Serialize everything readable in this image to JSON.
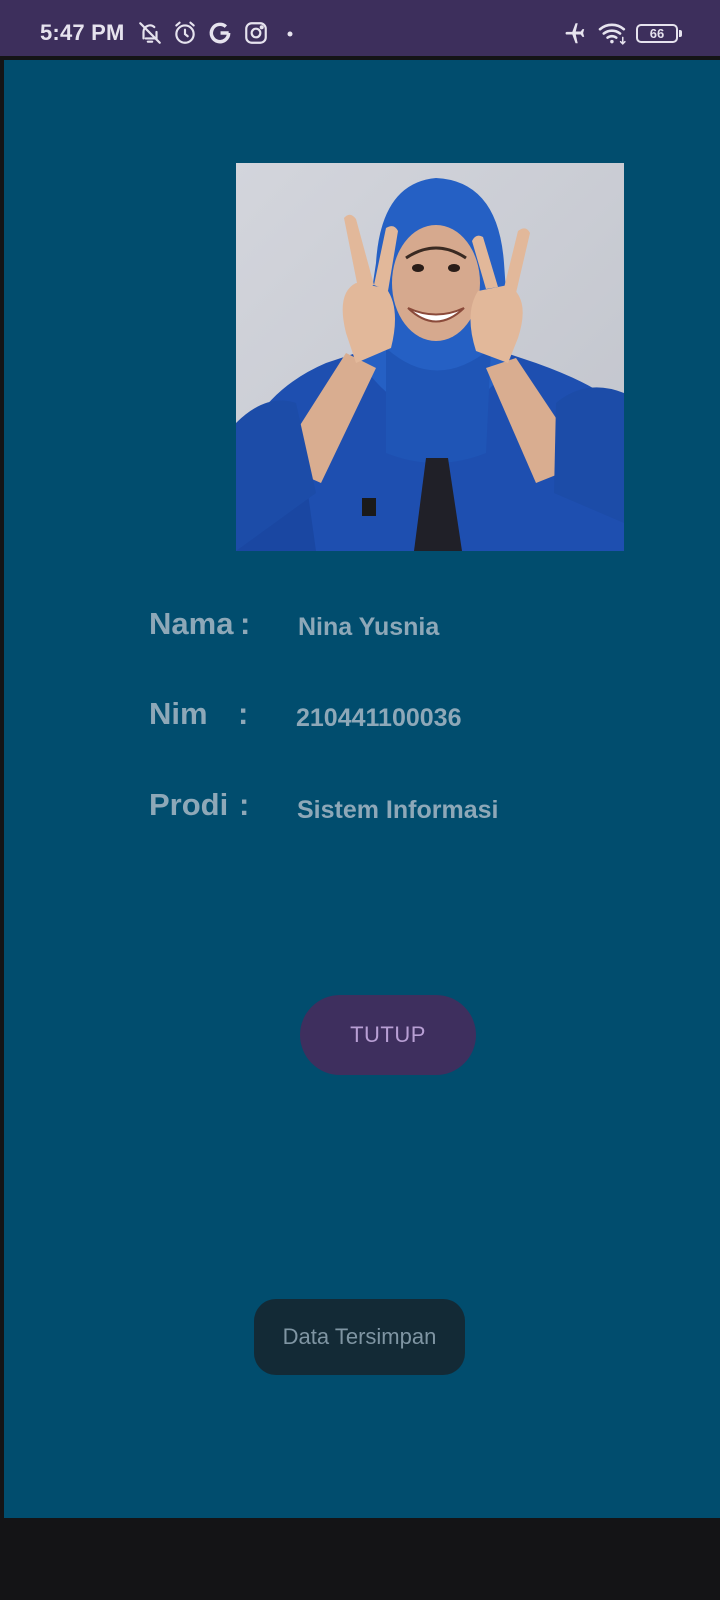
{
  "status_bar": {
    "time": "5:47 PM",
    "icons_left": [
      "notifications-off-icon",
      "alarm-icon",
      "google-icon",
      "instagram-icon",
      "dot-icon"
    ],
    "icons_right": [
      "airplane-icon",
      "wifi-icon",
      "battery-icon"
    ],
    "battery_level": "66"
  },
  "profile": {
    "photo_icon": "profile-photo",
    "fields": [
      {
        "label": "Nama",
        "colon": ":",
        "value": "Nina Yusnia"
      },
      {
        "label": "Nim",
        "colon": ":",
        "value": "210441100036"
      },
      {
        "label": "Prodi",
        "colon": ":",
        "value": "Sistem Informasi"
      }
    ]
  },
  "actions": {
    "close_label": "TUTUP"
  },
  "toast": {
    "message": "Data Tersimpan"
  },
  "colors": {
    "status_bar": "#3d2f5c",
    "app_background": "#014d6e",
    "button": "#3e2f5e",
    "text": "#8ea8b8"
  }
}
